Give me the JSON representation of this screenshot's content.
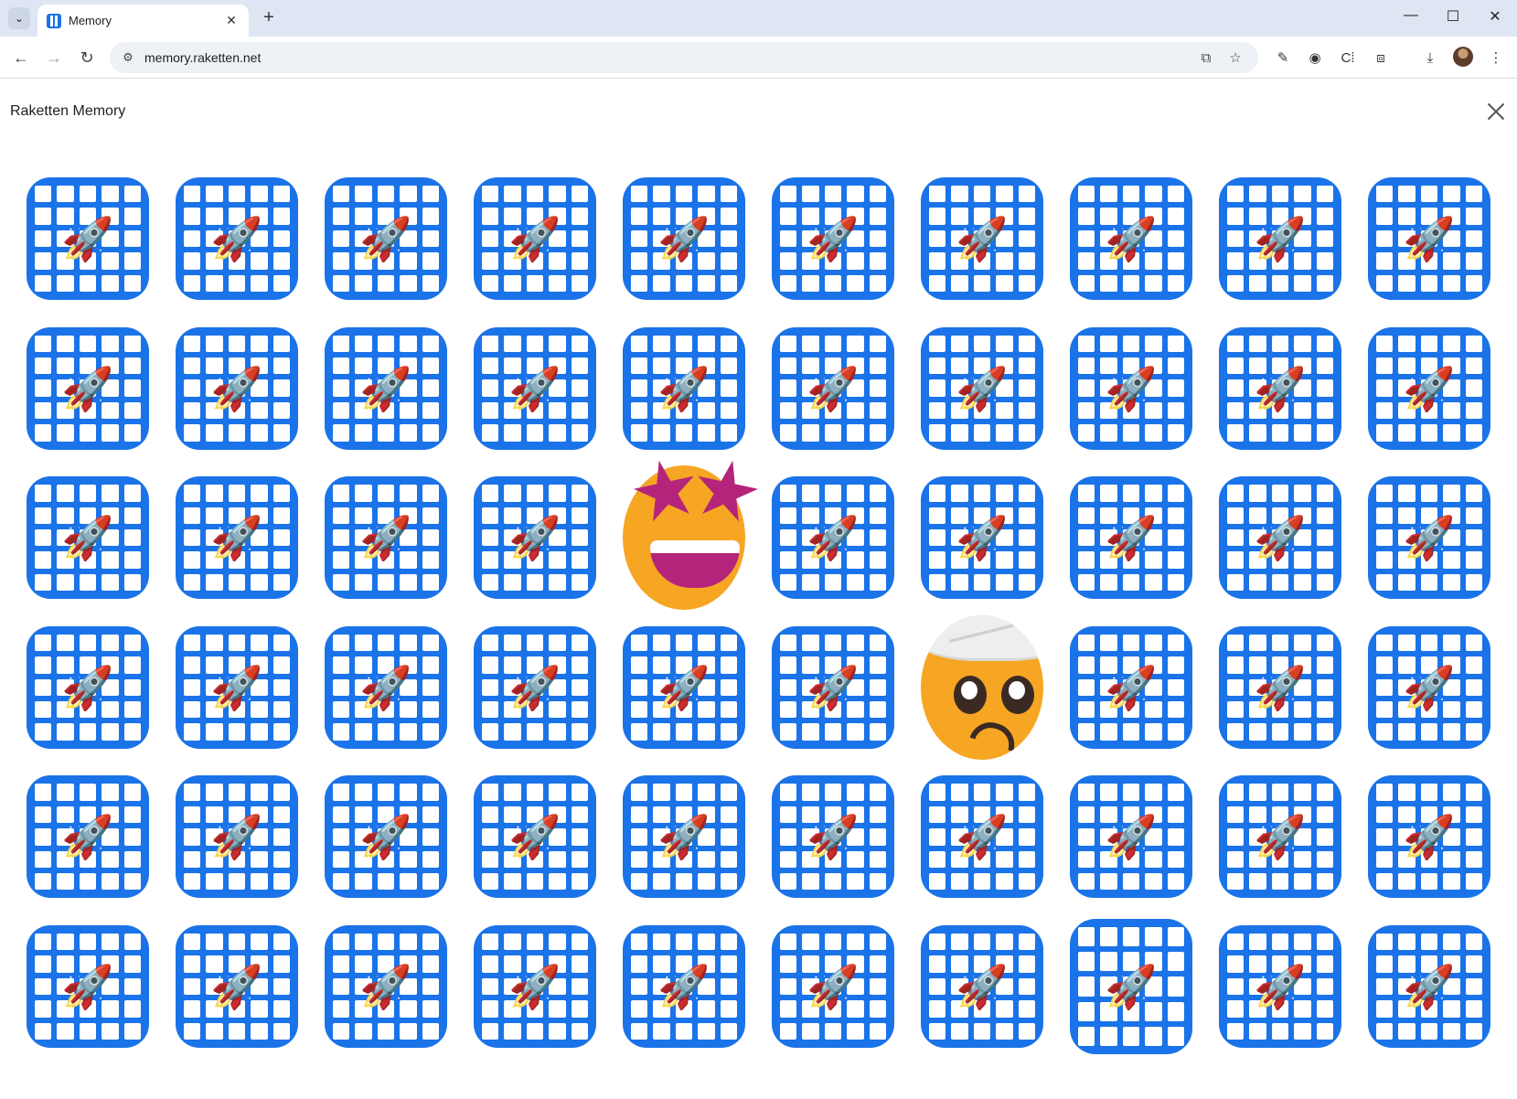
{
  "browser": {
    "tab_title": "Memory",
    "tab_close": "✕",
    "new_tab": "+",
    "tab_search": "⌄",
    "url": "memory.raketten.net",
    "window": {
      "minimize": "—",
      "maximize": "☐",
      "close": "✕"
    },
    "nav": {
      "back": "←",
      "forward": "→",
      "reload": "↻"
    },
    "omnibox_icons": {
      "site_info": "⚙",
      "open_in_app": "⧉",
      "bookmark": "☆"
    },
    "toolbar_icons": {
      "eyedropper": "✎",
      "extension_1": "◉",
      "extension_2": "C⁞",
      "extensions": "⧈",
      "downloads": "⤓",
      "menu": "⋮"
    }
  },
  "app": {
    "title": "Raketten Memory",
    "close_label": "close"
  },
  "board": {
    "rows": 6,
    "columns": 10,
    "card_back_emoji": "🚀",
    "revealed": [
      {
        "row": 3,
        "column": 5,
        "emoji_name": "star-struck"
      },
      {
        "row": 4,
        "column": 7,
        "emoji_name": "face-with-head-bandage"
      }
    ],
    "hovered": {
      "row": 6,
      "column": 8
    },
    "colors": {
      "card_back": "#1a73e8",
      "face_yellow": "#f6a623",
      "star_magenta": "#b5247b"
    }
  }
}
